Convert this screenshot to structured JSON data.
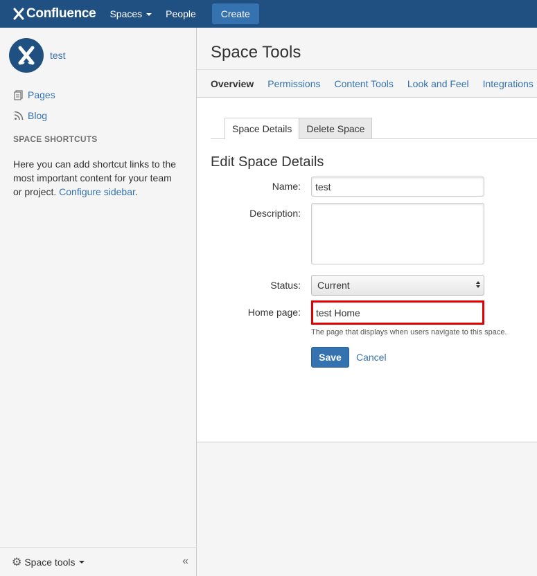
{
  "header": {
    "logo_text": "Confluence",
    "nav": [
      {
        "label": "Spaces",
        "has_dropdown": true
      },
      {
        "label": "People",
        "has_dropdown": false
      }
    ],
    "create_label": "Create"
  },
  "sidebar": {
    "space_name": "test",
    "links": [
      {
        "label": "Pages",
        "icon": "pages-icon"
      },
      {
        "label": "Blog",
        "icon": "rss-icon"
      }
    ],
    "shortcuts_title": "SPACE SHORTCUTS",
    "shortcuts_text": "Here you can add shortcut links to the most important content for your team or project.",
    "configure_link": "Configure sidebar",
    "configure_suffix": ".",
    "footer_label": "Space tools",
    "collapse_label": "«"
  },
  "main": {
    "title": "Space Tools",
    "tabs": [
      {
        "label": "Overview",
        "active": true
      },
      {
        "label": "Permissions",
        "active": false
      },
      {
        "label": "Content Tools",
        "active": false
      },
      {
        "label": "Look and Feel",
        "active": false
      },
      {
        "label": "Integrations",
        "active": false
      }
    ],
    "sub_tabs": [
      {
        "label": "Space Details",
        "active": true
      },
      {
        "label": "Delete Space",
        "active": false
      }
    ],
    "form": {
      "title": "Edit Space Details",
      "name_label": "Name:",
      "name_value": "test",
      "description_label": "Description:",
      "description_value": "",
      "status_label": "Status:",
      "status_value": "Current",
      "homepage_label": "Home page:",
      "homepage_value": "test Home",
      "homepage_hint": "The page that displays when users navigate to this space.",
      "save_label": "Save",
      "cancel_label": "Cancel"
    }
  },
  "colors": {
    "header_bg": "#205081",
    "link": "#3572b0",
    "highlight": "#e00000"
  }
}
